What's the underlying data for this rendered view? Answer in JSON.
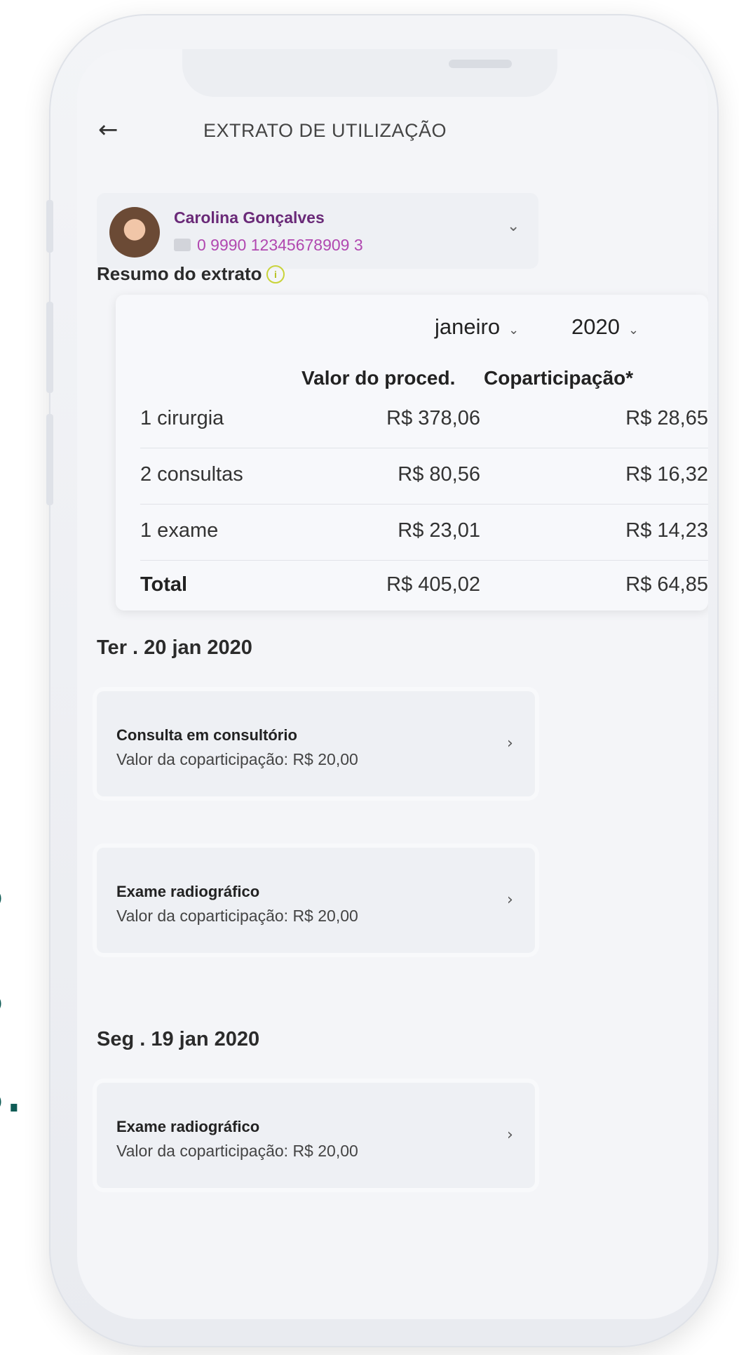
{
  "background_text": [
    "s",
    "s",
    "s."
  ],
  "header": {
    "back_icon": "arrow-left-icon",
    "title": "EXTRATO DE UTILIZAÇÃO"
  },
  "profile": {
    "name": "Carolina Gonçalves",
    "card_number": "0 9990 12345678909 3",
    "card_icon": "card-icon",
    "chevron_icon": "chevron-down-icon"
  },
  "summary": {
    "title": "Resumo do extrato",
    "info_icon": "info-icon",
    "month": "janeiro",
    "year": "2020",
    "columns": [
      "Valor do proced.",
      "Coparticipação*"
    ],
    "rows": [
      {
        "label": "1 cirurgia",
        "valor": "R$ 378,06",
        "copart": "R$ 28,65"
      },
      {
        "label": "2 consultas",
        "valor": "R$ 80,56",
        "copart": "R$ 16,32"
      },
      {
        "label": "1 exame",
        "valor": "R$ 23,01",
        "copart": "R$ 14,23"
      },
      {
        "label": "Total",
        "valor": "R$ 405,02",
        "copart": "R$ 64,85"
      }
    ]
  },
  "groups": [
    {
      "date": "Ter . 20 jan 2020",
      "items": [
        {
          "title": "Consulta em consultório",
          "subtitle": "Valor da coparticipação: R$ 20,00"
        },
        {
          "title": "Exame radiográfico",
          "subtitle": "Valor da coparticipação: R$ 20,00"
        }
      ]
    },
    {
      "date": "Seg . 19 jan 2020",
      "items": [
        {
          "title": "Exame radiográfico",
          "subtitle": "Valor da coparticipação: R$ 20,00"
        }
      ]
    }
  ],
  "colors": {
    "accent_purple": "#6a2a78",
    "number_pink": "#b148b0",
    "bg_text_green": "#0f5b55",
    "info_yellow": "#c9d33a"
  }
}
